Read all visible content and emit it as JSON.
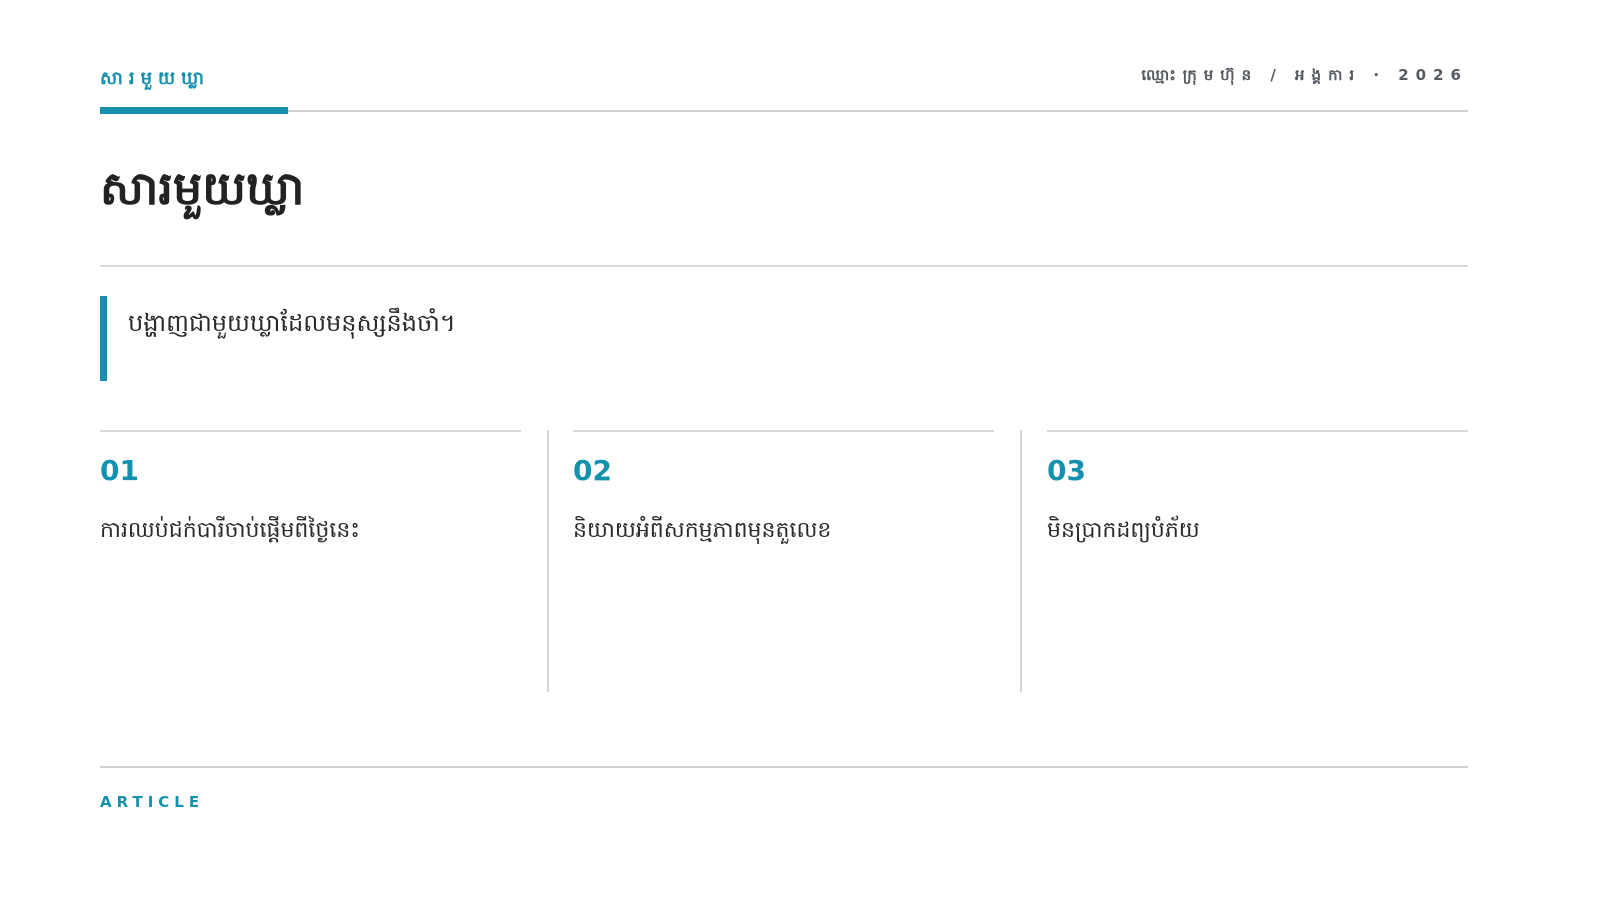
{
  "header": {
    "kicker": "សារមួយឃ្លា",
    "meta": "ឈ្មោះក្រុមហ៊ុន / អង្គការ · 2026"
  },
  "title": "សារមួយឃ្លា",
  "quote": "បង្ហាញជាមួយឃ្លាដែលមនុស្សនឹងចាំ។",
  "points": [
    {
      "number": "01",
      "text": "ការឈប់ជក់បារីចាប់ផ្តើមពីថ្ងៃនេះ"
    },
    {
      "number": "02",
      "text": "និយាយអំពីសកម្មភាពមុនតួលេខ"
    },
    {
      "number": "03",
      "text": "មិនប្រាកដព្យបំភ័យ"
    }
  ],
  "footer": {
    "label": "ARTICLE"
  },
  "colors": {
    "accent": "#1491ad",
    "rule": "#cfcfcf",
    "text": "#222222",
    "meta": "#555b61"
  }
}
